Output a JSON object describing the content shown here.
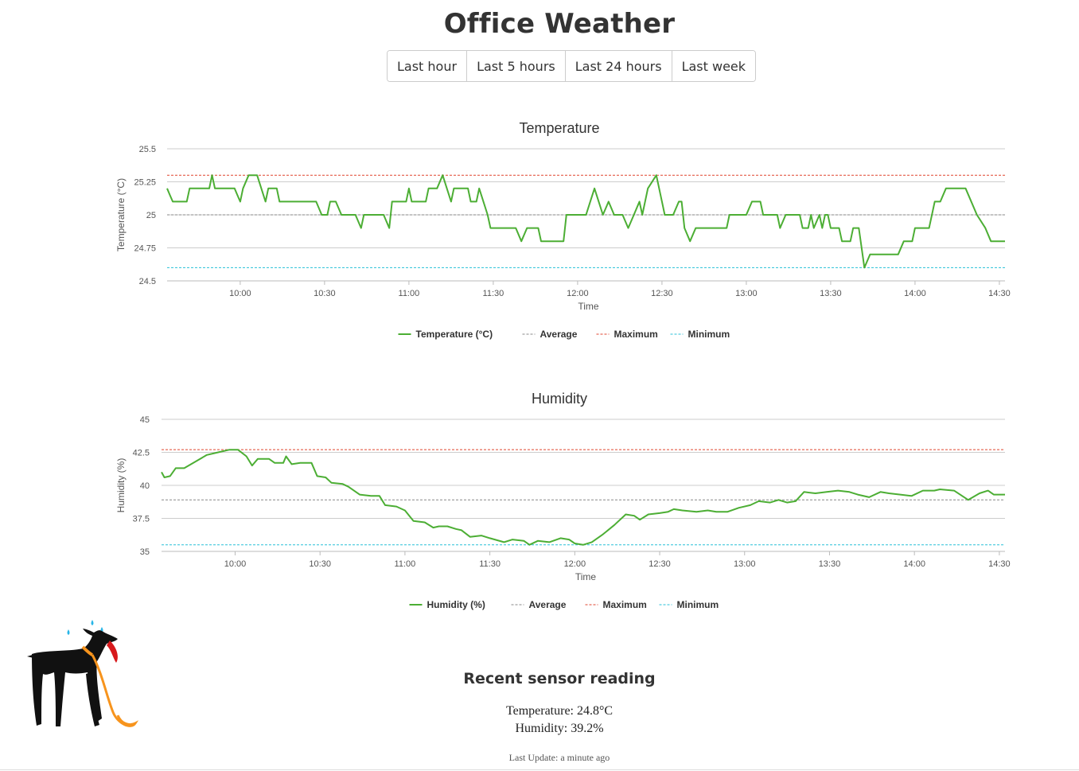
{
  "page": {
    "title": "Office Weather"
  },
  "ranges": [
    {
      "label": "Last hour"
    },
    {
      "label": "Last 5 hours"
    },
    {
      "label": "Last 24 hours"
    },
    {
      "label": "Last week"
    }
  ],
  "chart_data": [
    {
      "type": "line",
      "title": "Temperature",
      "xlabel": "Time",
      "ylabel": "Temperature (°C)",
      "ylim": [
        24.5,
        25.5
      ],
      "y_ticks": [
        "24.5",
        "24.75",
        "25",
        "25.25",
        "25.5"
      ],
      "x_ticks": [
        "10:00",
        "10:30",
        "11:00",
        "11:30",
        "12:00",
        "12:30",
        "13:00",
        "13:30",
        "14:00",
        "14:30"
      ],
      "xlim": [
        "09:34",
        "14:32"
      ],
      "grid": true,
      "legend": "bottom",
      "legend_labels": [
        "Temperature (°C)",
        "Average",
        "Maximum",
        "Minimum"
      ],
      "reference_lines": {
        "average": 25.0,
        "maximum": 25.3,
        "minimum": 24.6
      },
      "colors": {
        "series": "#4cae34",
        "average": "#888888",
        "maximum": "#e0452f",
        "minimum": "#28c0d8",
        "grid": "#cccccc"
      },
      "series": [
        {
          "name": "Temperature (°C)",
          "points": [
            [
              "09:34",
              25.2
            ],
            [
              "09:35",
              25.15
            ],
            [
              "09:36",
              25.1
            ],
            [
              "09:41",
              25.1
            ],
            [
              "09:42",
              25.2
            ],
            [
              "09:49",
              25.2
            ],
            [
              "09:50",
              25.3
            ],
            [
              "09:51",
              25.2
            ],
            [
              "09:58",
              25.2
            ],
            [
              "09:59",
              25.15
            ],
            [
              "10:00",
              25.1
            ],
            [
              "10:01",
              25.2
            ],
            [
              "10:03",
              25.3
            ],
            [
              "10:06",
              25.3
            ],
            [
              "10:09",
              25.1
            ],
            [
              "10:10",
              25.2
            ],
            [
              "10:13",
              25.2
            ],
            [
              "10:14",
              25.1
            ],
            [
              "10:27",
              25.1
            ],
            [
              "10:29",
              25.0
            ],
            [
              "10:31",
              25.0
            ],
            [
              "10:32",
              25.1
            ],
            [
              "10:34",
              25.1
            ],
            [
              "10:36",
              25.0
            ],
            [
              "10:41",
              25.0
            ],
            [
              "10:43",
              24.9
            ],
            [
              "10:44",
              25.0
            ],
            [
              "10:51",
              25.0
            ],
            [
              "10:53",
              24.9
            ],
            [
              "10:54",
              25.1
            ],
            [
              "10:59",
              25.1
            ],
            [
              "11:00",
              25.2
            ],
            [
              "11:01",
              25.1
            ],
            [
              "11:06",
              25.1
            ],
            [
              "11:07",
              25.2
            ],
            [
              "11:10",
              25.2
            ],
            [
              "11:12",
              25.3
            ],
            [
              "11:15",
              25.1
            ],
            [
              "11:16",
              25.2
            ],
            [
              "11:21",
              25.2
            ],
            [
              "11:22",
              25.1
            ],
            [
              "11:24",
              25.1
            ],
            [
              "11:25",
              25.2
            ],
            [
              "11:28",
              25.0
            ],
            [
              "11:29",
              24.9
            ],
            [
              "11:38",
              24.9
            ],
            [
              "11:40",
              24.8
            ],
            [
              "11:42",
              24.9
            ],
            [
              "11:46",
              24.9
            ],
            [
              "11:47",
              24.8
            ],
            [
              "11:55",
              24.8
            ],
            [
              "11:56",
              25.0
            ],
            [
              "12:03",
              25.0
            ],
            [
              "12:06",
              25.2
            ],
            [
              "12:09",
              25.0
            ],
            [
              "12:11",
              25.1
            ],
            [
              "12:13",
              25.0
            ],
            [
              "12:16",
              25.0
            ],
            [
              "12:18",
              24.9
            ],
            [
              "12:20",
              25.0
            ],
            [
              "12:22",
              25.1
            ],
            [
              "12:23",
              25.0
            ],
            [
              "12:25",
              25.2
            ],
            [
              "12:28",
              25.3
            ],
            [
              "12:30",
              25.1
            ],
            [
              "12:31",
              25.0
            ],
            [
              "12:34",
              25.0
            ],
            [
              "12:36",
              25.1
            ],
            [
              "12:37",
              25.1
            ],
            [
              "12:38",
              24.9
            ],
            [
              "12:40",
              24.8
            ],
            [
              "12:42",
              24.9
            ],
            [
              "12:53",
              24.9
            ],
            [
              "12:54",
              25.0
            ],
            [
              "13:00",
              25.0
            ],
            [
              "13:02",
              25.1
            ],
            [
              "13:05",
              25.1
            ],
            [
              "13:06",
              25.0
            ],
            [
              "13:11",
              25.0
            ],
            [
              "13:12",
              24.9
            ],
            [
              "13:14",
              25.0
            ],
            [
              "13:19",
              25.0
            ],
            [
              "13:20",
              24.9
            ],
            [
              "13:22",
              24.9
            ],
            [
              "13:23",
              25.0
            ],
            [
              "13:24",
              24.9
            ],
            [
              "13:26",
              25.0
            ],
            [
              "13:27",
              24.9
            ],
            [
              "13:28",
              25.0
            ],
            [
              "13:29",
              25.0
            ],
            [
              "13:30",
              24.9
            ],
            [
              "13:33",
              24.9
            ],
            [
              "13:34",
              24.8
            ],
            [
              "13:37",
              24.8
            ],
            [
              "13:38",
              24.9
            ],
            [
              "13:40",
              24.9
            ],
            [
              "13:42",
              24.6
            ],
            [
              "13:44",
              24.7
            ],
            [
              "13:54",
              24.7
            ],
            [
              "13:56",
              24.8
            ],
            [
              "13:59",
              24.8
            ],
            [
              "14:00",
              24.9
            ],
            [
              "14:05",
              24.9
            ],
            [
              "14:07",
              25.1
            ],
            [
              "14:09",
              25.1
            ],
            [
              "14:11",
              25.2
            ],
            [
              "14:18",
              25.2
            ],
            [
              "14:22",
              25.0
            ],
            [
              "14:25",
              24.9
            ],
            [
              "14:27",
              24.8
            ],
            [
              "14:32",
              24.8
            ]
          ]
        }
      ]
    },
    {
      "type": "line",
      "title": "Humidity",
      "xlabel": "Time",
      "ylabel": "Humidity (%)",
      "ylim": [
        35,
        45
      ],
      "y_ticks": [
        "35",
        "37.5",
        "40",
        "42.5",
        "45"
      ],
      "x_ticks": [
        "10:00",
        "10:30",
        "11:00",
        "11:30",
        "12:00",
        "12:30",
        "13:00",
        "13:30",
        "14:00",
        "14:30"
      ],
      "xlim": [
        "09:34",
        "14:32"
      ],
      "grid": true,
      "legend": "bottom",
      "legend_labels": [
        "Humidity (%)",
        "Average",
        "Maximum",
        "Minimum"
      ],
      "reference_lines": {
        "average": 38.9,
        "maximum": 42.7,
        "minimum": 35.5
      },
      "colors": {
        "series": "#4cae34",
        "average": "#888888",
        "maximum": "#e0452f",
        "minimum": "#28c0d8",
        "grid": "#cccccc"
      },
      "series": [
        {
          "name": "Humidity (%)",
          "points": [
            [
              "09:34",
              41.0
            ],
            [
              "09:35",
              40.6
            ],
            [
              "09:37",
              40.7
            ],
            [
              "09:39",
              41.3
            ],
            [
              "09:42",
              41.3
            ],
            [
              "09:46",
              41.8
            ],
            [
              "09:50",
              42.3
            ],
            [
              "09:54",
              42.5
            ],
            [
              "09:58",
              42.7
            ],
            [
              "10:01",
              42.7
            ],
            [
              "10:04",
              42.2
            ],
            [
              "10:06",
              41.5
            ],
            [
              "10:08",
              42.0
            ],
            [
              "10:12",
              42.0
            ],
            [
              "10:14",
              41.7
            ],
            [
              "10:17",
              41.7
            ],
            [
              "10:18",
              42.2
            ],
            [
              "10:20",
              41.6
            ],
            [
              "10:23",
              41.7
            ],
            [
              "10:27",
              41.7
            ],
            [
              "10:29",
              40.7
            ],
            [
              "10:32",
              40.6
            ],
            [
              "10:34",
              40.2
            ],
            [
              "10:38",
              40.1
            ],
            [
              "10:40",
              39.9
            ],
            [
              "10:44",
              39.3
            ],
            [
              "10:48",
              39.2
            ],
            [
              "10:51",
              39.2
            ],
            [
              "10:53",
              38.5
            ],
            [
              "10:57",
              38.4
            ],
            [
              "11:00",
              38.1
            ],
            [
              "11:03",
              37.3
            ],
            [
              "11:07",
              37.2
            ],
            [
              "11:10",
              36.8
            ],
            [
              "11:12",
              36.9
            ],
            [
              "11:15",
              36.9
            ],
            [
              "11:18",
              36.7
            ],
            [
              "11:20",
              36.6
            ],
            [
              "11:23",
              36.1
            ],
            [
              "11:27",
              36.2
            ],
            [
              "11:30",
              36.0
            ],
            [
              "11:35",
              35.7
            ],
            [
              "11:38",
              35.9
            ],
            [
              "11:42",
              35.8
            ],
            [
              "11:44",
              35.5
            ],
            [
              "11:47",
              35.8
            ],
            [
              "11:51",
              35.7
            ],
            [
              "11:55",
              36.0
            ],
            [
              "11:58",
              35.9
            ],
            [
              "12:00",
              35.6
            ],
            [
              "12:03",
              35.5
            ],
            [
              "12:06",
              35.7
            ],
            [
              "12:10",
              36.3
            ],
            [
              "12:14",
              37.0
            ],
            [
              "12:18",
              37.8
            ],
            [
              "12:21",
              37.7
            ],
            [
              "12:23",
              37.4
            ],
            [
              "12:26",
              37.8
            ],
            [
              "12:30",
              37.9
            ],
            [
              "12:33",
              38.0
            ],
            [
              "12:35",
              38.2
            ],
            [
              "12:38",
              38.1
            ],
            [
              "12:43",
              38.0
            ],
            [
              "12:47",
              38.1
            ],
            [
              "12:50",
              38.0
            ],
            [
              "12:54",
              38.0
            ],
            [
              "12:58",
              38.3
            ],
            [
              "13:02",
              38.5
            ],
            [
              "13:05",
              38.8
            ],
            [
              "13:09",
              38.7
            ],
            [
              "13:12",
              38.9
            ],
            [
              "13:15",
              38.7
            ],
            [
              "13:18",
              38.8
            ],
            [
              "13:21",
              39.5
            ],
            [
              "13:25",
              39.4
            ],
            [
              "13:29",
              39.5
            ],
            [
              "13:33",
              39.6
            ],
            [
              "13:37",
              39.5
            ],
            [
              "13:40",
              39.3
            ],
            [
              "13:44",
              39.1
            ],
            [
              "13:48",
              39.5
            ],
            [
              "13:51",
              39.4
            ],
            [
              "13:55",
              39.3
            ],
            [
              "13:59",
              39.2
            ],
            [
              "14:03",
              39.6
            ],
            [
              "14:07",
              39.6
            ],
            [
              "14:09",
              39.7
            ],
            [
              "14:14",
              39.6
            ],
            [
              "14:19",
              38.9
            ],
            [
              "14:23",
              39.4
            ],
            [
              "14:26",
              39.6
            ],
            [
              "14:28",
              39.3
            ],
            [
              "14:32",
              39.3
            ]
          ]
        }
      ]
    }
  ],
  "recent": {
    "title": "Recent sensor reading",
    "temperature": "Temperature: 24.8°C",
    "humidity": "Humidity: 39.2%",
    "last_update": "Last Update: a minute ago"
  }
}
